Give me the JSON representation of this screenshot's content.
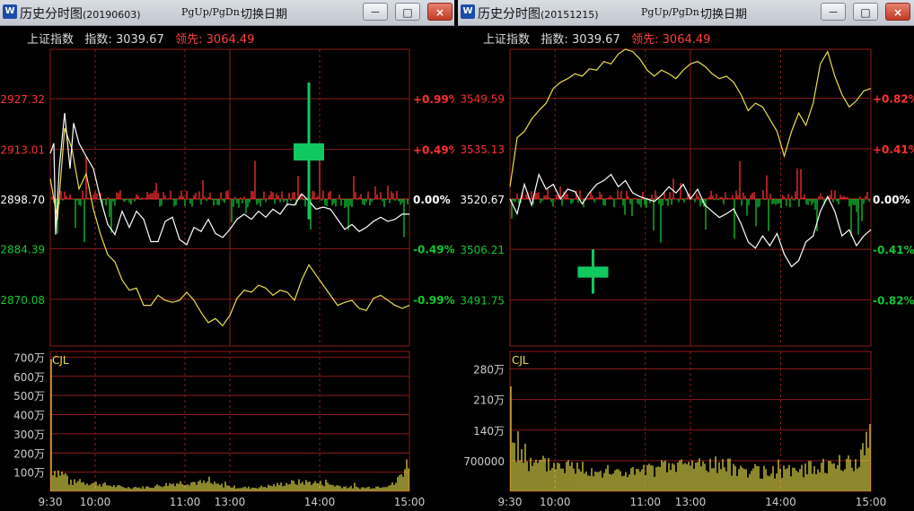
{
  "colors": {
    "grid": "#8e1a1a",
    "price_line": "#ffffff",
    "avg_line": "#e8e04a",
    "up": "#ff3030",
    "down": "#11c831",
    "neutral": "#ffffff",
    "volume": "#e8e04a",
    "axis_text": "#cccccc"
  },
  "windows": [
    {
      "title": "历史分时图",
      "date": "(20190603)",
      "pg_hint": "PgUp/PgDn",
      "switch_label": "切换日期",
      "btn_min": "－",
      "btn_max": "□",
      "btn_close": "×",
      "index_name": "上证指数",
      "index_label": "指数:",
      "index_value": "3039.67",
      "lead_label": "领先:",
      "lead_value": "3064.49",
      "vol_label": "CJL",
      "left_axis": [
        {
          "label": "2927.32",
          "pct": 0.99
        },
        {
          "label": "2913.01",
          "pct": 0.49
        },
        {
          "label": "2898.70",
          "pct": 0
        },
        {
          "label": "2884.39",
          "pct": -0.49
        },
        {
          "label": "2870.08",
          "pct": -0.99
        }
      ],
      "right_axis": [
        {
          "label": "+0.99%",
          "pct": 0.99
        },
        {
          "label": "+0.49%",
          "pct": 0.49
        },
        {
          "label": "0.00%",
          "pct": 0
        },
        {
          "label": "-0.49%",
          "pct": -0.49
        },
        {
          "label": "-0.99%",
          "pct": -0.99
        }
      ],
      "vol_axis": [
        {
          "label": "700万",
          "v": 7
        },
        {
          "label": "600万",
          "v": 6
        },
        {
          "label": "500万",
          "v": 5
        },
        {
          "label": "400万",
          "v": 4
        },
        {
          "label": "300万",
          "v": 3
        },
        {
          "label": "200万",
          "v": 2
        },
        {
          "label": "100万",
          "v": 1
        }
      ],
      "vol_max": 7.3,
      "time_axis": [
        {
          "label": "9:30",
          "f": 0
        },
        {
          "label": "10:00",
          "f": 0.125
        },
        {
          "label": "11:00",
          "f": 0.375
        },
        {
          "label": "13:00",
          "f": 0.5
        },
        {
          "label": "14:00",
          "f": 0.75
        },
        {
          "label": "15:00",
          "f": 1
        }
      ],
      "candle": {
        "t": 0.72,
        "high": 1.15,
        "low": -0.2,
        "open": 0.55,
        "close": 0.38
      },
      "price_pts": [
        [
          0,
          0.45
        ],
        [
          0.01,
          0.55
        ],
        [
          0.015,
          -0.35
        ],
        [
          0.025,
          0.3
        ],
        [
          0.04,
          0.85
        ],
        [
          0.055,
          0.3
        ],
        [
          0.065,
          0.75
        ],
        [
          0.08,
          0.55
        ],
        [
          0.1,
          0.42
        ],
        [
          0.12,
          0.3
        ],
        [
          0.14,
          0.0
        ],
        [
          0.16,
          -0.25
        ],
        [
          0.18,
          -0.35
        ],
        [
          0.2,
          -0.12
        ],
        [
          0.22,
          -0.28
        ],
        [
          0.24,
          -0.12
        ],
        [
          0.26,
          -0.2
        ],
        [
          0.28,
          -0.42
        ],
        [
          0.3,
          -0.42
        ],
        [
          0.32,
          -0.22
        ],
        [
          0.34,
          -0.18
        ],
        [
          0.36,
          -0.4
        ],
        [
          0.38,
          -0.45
        ],
        [
          0.4,
          -0.28
        ],
        [
          0.42,
          -0.32
        ],
        [
          0.44,
          -0.2
        ],
        [
          0.46,
          -0.34
        ],
        [
          0.48,
          -0.38
        ],
        [
          0.5,
          -0.3
        ],
        [
          0.52,
          -0.2
        ],
        [
          0.54,
          -0.15
        ],
        [
          0.56,
          -0.2
        ],
        [
          0.58,
          -0.12
        ],
        [
          0.6,
          -0.18
        ],
        [
          0.62,
          -0.1
        ],
        [
          0.64,
          -0.15
        ],
        [
          0.66,
          -0.05
        ],
        [
          0.68,
          -0.06
        ],
        [
          0.7,
          0.05
        ],
        [
          0.72,
          -0.02
        ],
        [
          0.74,
          -0.1
        ],
        [
          0.76,
          -0.08
        ],
        [
          0.78,
          -0.1
        ],
        [
          0.8,
          -0.2
        ],
        [
          0.82,
          -0.3
        ],
        [
          0.84,
          -0.25
        ],
        [
          0.86,
          -0.32
        ],
        [
          0.88,
          -0.28
        ],
        [
          0.9,
          -0.22
        ],
        [
          0.92,
          -0.18
        ],
        [
          0.94,
          -0.22
        ],
        [
          0.96,
          -0.2
        ],
        [
          0.98,
          -0.15
        ],
        [
          1,
          -0.15
        ]
      ],
      "avg_pts": [
        [
          0,
          0.2
        ],
        [
          0.02,
          -0.2
        ],
        [
          0.04,
          0.7
        ],
        [
          0.06,
          0.5
        ],
        [
          0.08,
          0.1
        ],
        [
          0.1,
          0.25
        ],
        [
          0.12,
          -0.1
        ],
        [
          0.14,
          -0.35
        ],
        [
          0.16,
          -0.55
        ],
        [
          0.18,
          -0.62
        ],
        [
          0.2,
          -0.8
        ],
        [
          0.22,
          -0.9
        ],
        [
          0.24,
          -0.88
        ],
        [
          0.26,
          -1.05
        ],
        [
          0.28,
          -1.05
        ],
        [
          0.3,
          -0.95
        ],
        [
          0.32,
          -1.0
        ],
        [
          0.34,
          -1.02
        ],
        [
          0.36,
          -1.0
        ],
        [
          0.38,
          -0.92
        ],
        [
          0.4,
          -1.0
        ],
        [
          0.42,
          -1.12
        ],
        [
          0.44,
          -1.22
        ],
        [
          0.46,
          -1.18
        ],
        [
          0.48,
          -1.25
        ],
        [
          0.5,
          -1.15
        ],
        [
          0.52,
          -0.98
        ],
        [
          0.54,
          -0.9
        ],
        [
          0.56,
          -0.92
        ],
        [
          0.58,
          -0.85
        ],
        [
          0.6,
          -0.88
        ],
        [
          0.62,
          -0.95
        ],
        [
          0.64,
          -0.9
        ],
        [
          0.66,
          -0.92
        ],
        [
          0.68,
          -1.0
        ],
        [
          0.7,
          -0.8
        ],
        [
          0.72,
          -0.65
        ],
        [
          0.74,
          -0.75
        ],
        [
          0.76,
          -0.85
        ],
        [
          0.78,
          -0.95
        ],
        [
          0.8,
          -1.05
        ],
        [
          0.82,
          -1.02
        ],
        [
          0.84,
          -1.0
        ],
        [
          0.86,
          -1.08
        ],
        [
          0.88,
          -1.1
        ],
        [
          0.9,
          -0.98
        ],
        [
          0.92,
          -0.95
        ],
        [
          0.94,
          -1.0
        ],
        [
          0.96,
          -1.05
        ],
        [
          0.98,
          -1.08
        ],
        [
          1,
          -1.05
        ]
      ],
      "flow_seed": 3,
      "vol_seed": 7
    },
    {
      "title": "历史分时图",
      "date": "(20151215)",
      "pg_hint": "PgUp/PgDn",
      "switch_label": "切换日期",
      "btn_min": "－",
      "btn_max": "□",
      "btn_close": "×",
      "index_name": "上证指数",
      "index_label": "指数:",
      "index_value": "3039.67",
      "lead_label": "领先:",
      "lead_value": "3064.49",
      "vol_label": "CJL",
      "left_axis": [
        {
          "label": "3549.59",
          "pct": 0.82
        },
        {
          "label": "3535.13",
          "pct": 0.41
        },
        {
          "label": "3520.67",
          "pct": 0
        },
        {
          "label": "3506.21",
          "pct": -0.41
        },
        {
          "label": "3491.75",
          "pct": -0.82
        }
      ],
      "right_axis": [
        {
          "label": "+0.82%",
          "pct": 0.82
        },
        {
          "label": "+0.41%",
          "pct": 0.41
        },
        {
          "label": "0.00%",
          "pct": 0
        },
        {
          "label": "-0.41%",
          "pct": -0.41
        },
        {
          "label": "-0.82%",
          "pct": -0.82
        }
      ],
      "vol_axis": [
        {
          "label": "280万",
          "v": 2.8
        },
        {
          "label": "210万",
          "v": 2.1
        },
        {
          "label": "140万",
          "v": 1.4
        },
        {
          "label": "700000",
          "v": 0.7
        }
      ],
      "vol_max": 3.2,
      "time_axis": [
        {
          "label": "9:30",
          "f": 0
        },
        {
          "label": "10:00",
          "f": 0.125
        },
        {
          "label": "11:00",
          "f": 0.375
        },
        {
          "label": "13:00",
          "f": 0.5
        },
        {
          "label": "14:00",
          "f": 0.75
        },
        {
          "label": "15:00",
          "f": 1
        }
      ],
      "candle": {
        "t": 0.23,
        "high": -0.41,
        "low": -0.77,
        "open": -0.55,
        "close": -0.64
      },
      "price_pts": [
        [
          0,
          0.0
        ],
        [
          0.02,
          -0.12
        ],
        [
          0.04,
          0.12
        ],
        [
          0.06,
          -0.05
        ],
        [
          0.08,
          0.2
        ],
        [
          0.1,
          0.08
        ],
        [
          0.12,
          0.12
        ],
        [
          0.14,
          0.0
        ],
        [
          0.16,
          0.08
        ],
        [
          0.18,
          0.06
        ],
        [
          0.2,
          -0.04
        ],
        [
          0.22,
          0.05
        ],
        [
          0.24,
          0.12
        ],
        [
          0.26,
          0.15
        ],
        [
          0.28,
          0.2
        ],
        [
          0.3,
          0.1
        ],
        [
          0.32,
          0.15
        ],
        [
          0.34,
          0.05
        ],
        [
          0.36,
          0.02
        ],
        [
          0.38,
          0.0
        ],
        [
          0.4,
          -0.02
        ],
        [
          0.42,
          0.03
        ],
        [
          0.44,
          0.1
        ],
        [
          0.46,
          0.05
        ],
        [
          0.48,
          0.12
        ],
        [
          0.5,
          0.0
        ],
        [
          0.52,
          0.08
        ],
        [
          0.54,
          -0.05
        ],
        [
          0.56,
          -0.1
        ],
        [
          0.58,
          -0.15
        ],
        [
          0.6,
          -0.12
        ],
        [
          0.62,
          -0.08
        ],
        [
          0.64,
          -0.2
        ],
        [
          0.66,
          -0.35
        ],
        [
          0.68,
          -0.4
        ],
        [
          0.7,
          -0.3
        ],
        [
          0.72,
          -0.38
        ],
        [
          0.74,
          -0.28
        ],
        [
          0.76,
          -0.45
        ],
        [
          0.78,
          -0.55
        ],
        [
          0.8,
          -0.5
        ],
        [
          0.82,
          -0.35
        ],
        [
          0.84,
          -0.3
        ],
        [
          0.86,
          -0.1
        ],
        [
          0.88,
          0.02
        ],
        [
          0.9,
          -0.1
        ],
        [
          0.92,
          -0.3
        ],
        [
          0.94,
          -0.25
        ],
        [
          0.96,
          -0.38
        ],
        [
          0.98,
          -0.3
        ],
        [
          1,
          -0.25
        ]
      ],
      "avg_pts": [
        [
          0,
          0.1
        ],
        [
          0.02,
          0.5
        ],
        [
          0.04,
          0.55
        ],
        [
          0.06,
          0.65
        ],
        [
          0.08,
          0.72
        ],
        [
          0.1,
          0.78
        ],
        [
          0.12,
          0.9
        ],
        [
          0.14,
          0.95
        ],
        [
          0.16,
          0.98
        ],
        [
          0.18,
          1.02
        ],
        [
          0.2,
          1.0
        ],
        [
          0.22,
          1.06
        ],
        [
          0.24,
          1.05
        ],
        [
          0.26,
          1.12
        ],
        [
          0.28,
          1.1
        ],
        [
          0.3,
          1.18
        ],
        [
          0.32,
          1.22
        ],
        [
          0.34,
          1.2
        ],
        [
          0.36,
          1.14
        ],
        [
          0.38,
          1.05
        ],
        [
          0.4,
          1.0
        ],
        [
          0.42,
          1.05
        ],
        [
          0.44,
          1.02
        ],
        [
          0.46,
          0.98
        ],
        [
          0.48,
          1.05
        ],
        [
          0.5,
          1.1
        ],
        [
          0.52,
          1.12
        ],
        [
          0.54,
          1.08
        ],
        [
          0.56,
          1.02
        ],
        [
          0.58,
          0.98
        ],
        [
          0.6,
          1.0
        ],
        [
          0.62,
          0.95
        ],
        [
          0.64,
          0.85
        ],
        [
          0.66,
          0.72
        ],
        [
          0.68,
          0.78
        ],
        [
          0.7,
          0.75
        ],
        [
          0.72,
          0.65
        ],
        [
          0.74,
          0.55
        ],
        [
          0.76,
          0.35
        ],
        [
          0.78,
          0.55
        ],
        [
          0.8,
          0.7
        ],
        [
          0.82,
          0.6
        ],
        [
          0.84,
          0.78
        ],
        [
          0.86,
          1.1
        ],
        [
          0.88,
          1.2
        ],
        [
          0.9,
          1.0
        ],
        [
          0.92,
          0.85
        ],
        [
          0.94,
          0.75
        ],
        [
          0.96,
          0.8
        ],
        [
          0.98,
          0.88
        ],
        [
          1,
          0.9
        ]
      ],
      "flow_seed": 11,
      "vol_seed": 5
    }
  ]
}
